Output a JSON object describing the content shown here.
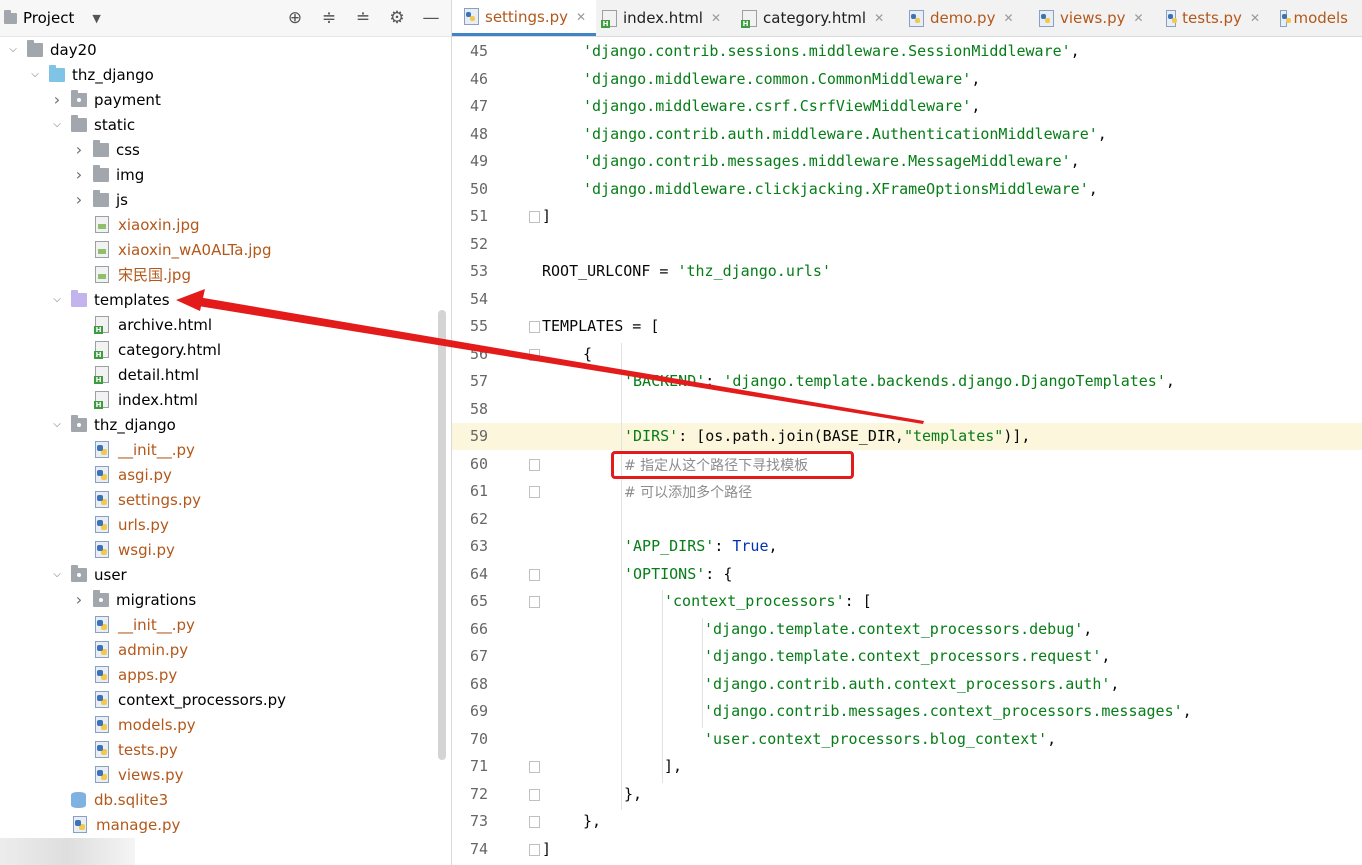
{
  "project_panel": {
    "title": "Project",
    "tree": [
      {
        "label": "day20",
        "level": 0,
        "arrow": "open",
        "icon": "folder",
        "color": "normal"
      },
      {
        "label": "thz_django",
        "level": 1,
        "arrow": "open",
        "icon": "folder-blue",
        "color": "normal"
      },
      {
        "label": "payment",
        "level": 2,
        "arrow": "closed",
        "icon": "folder-pkg",
        "color": "normal"
      },
      {
        "label": "static",
        "level": 2,
        "arrow": "open",
        "icon": "folder",
        "color": "normal"
      },
      {
        "label": "css",
        "level": 3,
        "arrow": "closed",
        "icon": "folder",
        "color": "normal"
      },
      {
        "label": "img",
        "level": 3,
        "arrow": "closed",
        "icon": "folder",
        "color": "normal"
      },
      {
        "label": "js",
        "level": 3,
        "arrow": "closed",
        "icon": "folder",
        "color": "normal"
      },
      {
        "label": "xiaoxin.jpg",
        "level": 3,
        "arrow": "none",
        "icon": "file-img",
        "color": "orange"
      },
      {
        "label": "xiaoxin_wA0ALTa.jpg",
        "level": 3,
        "arrow": "none",
        "icon": "file-img",
        "color": "orange"
      },
      {
        "label": "宋民国.jpg",
        "level": 3,
        "arrow": "none",
        "icon": "file-img",
        "color": "orange"
      },
      {
        "label": "templates",
        "level": 2,
        "arrow": "open",
        "icon": "folder-purple",
        "color": "normal"
      },
      {
        "label": "archive.html",
        "level": 3,
        "arrow": "none",
        "icon": "file-html",
        "color": "normal"
      },
      {
        "label": "category.html",
        "level": 3,
        "arrow": "none",
        "icon": "file-html",
        "color": "normal"
      },
      {
        "label": "detail.html",
        "level": 3,
        "arrow": "none",
        "icon": "file-html",
        "color": "normal"
      },
      {
        "label": "index.html",
        "level": 3,
        "arrow": "none",
        "icon": "file-html",
        "color": "normal"
      },
      {
        "label": "thz_django",
        "level": 2,
        "arrow": "open",
        "icon": "folder-pkg",
        "color": "normal"
      },
      {
        "label": "__init__.py",
        "level": 3,
        "arrow": "none",
        "icon": "file-py",
        "color": "orange"
      },
      {
        "label": "asgi.py",
        "level": 3,
        "arrow": "none",
        "icon": "file-py",
        "color": "orange"
      },
      {
        "label": "settings.py",
        "level": 3,
        "arrow": "none",
        "icon": "file-py",
        "color": "orange"
      },
      {
        "label": "urls.py",
        "level": 3,
        "arrow": "none",
        "icon": "file-py",
        "color": "orange"
      },
      {
        "label": "wsgi.py",
        "level": 3,
        "arrow": "none",
        "icon": "file-py",
        "color": "orange"
      },
      {
        "label": "user",
        "level": 2,
        "arrow": "open",
        "icon": "folder-pkg",
        "color": "normal"
      },
      {
        "label": "migrations",
        "level": 3,
        "arrow": "closed",
        "icon": "folder-pkg",
        "color": "normal"
      },
      {
        "label": "__init__.py",
        "level": 3,
        "arrow": "none",
        "icon": "file-py",
        "color": "orange"
      },
      {
        "label": "admin.py",
        "level": 3,
        "arrow": "none",
        "icon": "file-py",
        "color": "orange"
      },
      {
        "label": "apps.py",
        "level": 3,
        "arrow": "none",
        "icon": "file-py",
        "color": "orange"
      },
      {
        "label": "context_processors.py",
        "level": 3,
        "arrow": "none",
        "icon": "file-py",
        "color": "normal"
      },
      {
        "label": "models.py",
        "level": 3,
        "arrow": "none",
        "icon": "file-py",
        "color": "orange"
      },
      {
        "label": "tests.py",
        "level": 3,
        "arrow": "none",
        "icon": "file-py",
        "color": "orange"
      },
      {
        "label": "views.py",
        "level": 3,
        "arrow": "none",
        "icon": "file-py",
        "color": "orange"
      },
      {
        "label": "db.sqlite3",
        "level": 2,
        "arrow": "none",
        "icon": "db",
        "color": "orange"
      },
      {
        "label": "manage.py",
        "level": 2,
        "arrow": "none",
        "icon": "file-py",
        "color": "orange"
      }
    ]
  },
  "tabs": [
    {
      "label": "settings.py",
      "icon": "py",
      "active": true,
      "orange": true
    },
    {
      "label": "index.html",
      "icon": "html",
      "active": false,
      "orange": false
    },
    {
      "label": "category.html",
      "icon": "html",
      "active": false,
      "orange": false
    },
    {
      "label": "demo.py",
      "icon": "py",
      "active": false,
      "orange": true
    },
    {
      "label": "views.py",
      "icon": "py",
      "active": false,
      "orange": true
    },
    {
      "label": "tests.py",
      "icon": "py",
      "active": false,
      "orange": true
    },
    {
      "label": "models",
      "icon": "py",
      "active": false,
      "orange": true
    }
  ],
  "editor": {
    "highlighted_line": "59",
    "lines": [
      {
        "n": "45",
        "indent": 1,
        "parts": [
          [
            "str",
            "'django.contrib.sessions.middleware.SessionMiddleware'"
          ],
          [
            "p",
            ","
          ]
        ]
      },
      {
        "n": "46",
        "indent": 1,
        "parts": [
          [
            "str",
            "'django.middleware.common.CommonMiddleware'"
          ],
          [
            "p",
            ","
          ]
        ]
      },
      {
        "n": "47",
        "indent": 1,
        "parts": [
          [
            "str",
            "'django.middleware.csrf.CsrfViewMiddleware'"
          ],
          [
            "p",
            ","
          ]
        ]
      },
      {
        "n": "48",
        "indent": 1,
        "parts": [
          [
            "str",
            "'django.contrib.auth.middleware.AuthenticationMiddleware'"
          ],
          [
            "p",
            ","
          ]
        ]
      },
      {
        "n": "49",
        "indent": 1,
        "parts": [
          [
            "str",
            "'django.contrib.messages.middleware.MessageMiddleware'"
          ],
          [
            "p",
            ","
          ]
        ]
      },
      {
        "n": "50",
        "indent": 1,
        "parts": [
          [
            "str",
            "'django.middleware.clickjacking.XFrameOptionsMiddleware'"
          ],
          [
            "p",
            ","
          ]
        ]
      },
      {
        "n": "51",
        "indent": 0,
        "parts": [
          [
            "p",
            "]"
          ]
        ]
      },
      {
        "n": "52",
        "indent": 0,
        "parts": []
      },
      {
        "n": "53",
        "indent": 0,
        "parts": [
          [
            "p",
            "ROOT_URLCONF = "
          ],
          [
            "str",
            "'thz_django.urls'"
          ]
        ]
      },
      {
        "n": "54",
        "indent": 0,
        "parts": []
      },
      {
        "n": "55",
        "indent": 0,
        "parts": [
          [
            "p",
            "TEMPLATES = ["
          ]
        ]
      },
      {
        "n": "56",
        "indent": 1,
        "parts": [
          [
            "p",
            "{"
          ]
        ]
      },
      {
        "n": "57",
        "indent": 2,
        "parts": [
          [
            "str",
            "'BACKEND'"
          ],
          [
            "p",
            ": "
          ],
          [
            "str",
            "'django.template.backends.django.DjangoTemplates'"
          ],
          [
            "p",
            ","
          ]
        ]
      },
      {
        "n": "58",
        "indent": 0,
        "parts": []
      },
      {
        "n": "59",
        "indent": 2,
        "parts": [
          [
            "str",
            "'DIRS'"
          ],
          [
            "p",
            ": [os.path.join(BASE_DIR,"
          ],
          [
            "str",
            "\"templates\""
          ],
          [
            "p",
            ")],"
          ]
        ]
      },
      {
        "n": "60",
        "indent": 2,
        "parts": [
          [
            "cmt",
            "# 指定从这个路径下寻找模板"
          ]
        ]
      },
      {
        "n": "61",
        "indent": 2,
        "parts": [
          [
            "cmt",
            "# 可以添加多个路径"
          ]
        ]
      },
      {
        "n": "62",
        "indent": 0,
        "parts": []
      },
      {
        "n": "63",
        "indent": 2,
        "parts": [
          [
            "str",
            "'APP_DIRS'"
          ],
          [
            "p",
            ": "
          ],
          [
            "kw",
            "True"
          ],
          [
            "p",
            ","
          ]
        ]
      },
      {
        "n": "64",
        "indent": 2,
        "parts": [
          [
            "str",
            "'OPTIONS'"
          ],
          [
            "p",
            ": {"
          ]
        ]
      },
      {
        "n": "65",
        "indent": 3,
        "parts": [
          [
            "str",
            "'context_processors'"
          ],
          [
            "p",
            ": ["
          ]
        ]
      },
      {
        "n": "66",
        "indent": 4,
        "parts": [
          [
            "str",
            "'django.template.context_processors.debug'"
          ],
          [
            "p",
            ","
          ]
        ]
      },
      {
        "n": "67",
        "indent": 4,
        "parts": [
          [
            "str",
            "'django.template.context_processors.request'"
          ],
          [
            "p",
            ","
          ]
        ]
      },
      {
        "n": "68",
        "indent": 4,
        "parts": [
          [
            "str",
            "'django.contrib.auth.context_processors.auth'"
          ],
          [
            "p",
            ","
          ]
        ]
      },
      {
        "n": "69",
        "indent": 4,
        "parts": [
          [
            "str",
            "'django.contrib.messages.context_processors.messages'"
          ],
          [
            "p",
            ","
          ]
        ]
      },
      {
        "n": "70",
        "indent": 4,
        "parts": [
          [
            "str",
            "'user.context_processors.blog_context'"
          ],
          [
            "p",
            ","
          ]
        ]
      },
      {
        "n": "71",
        "indent": 3,
        "parts": [
          [
            "p",
            "],"
          ]
        ]
      },
      {
        "n": "72",
        "indent": 2,
        "parts": [
          [
            "p",
            "},"
          ]
        ]
      },
      {
        "n": "73",
        "indent": 1,
        "parts": [
          [
            "p",
            "},"
          ]
        ]
      },
      {
        "n": "74",
        "indent": 0,
        "parts": [
          [
            "p",
            "]"
          ]
        ]
      }
    ]
  },
  "colors": {
    "string": "#067d17",
    "keyword": "#0033b3",
    "comment": "#8c8c8c",
    "annotation_red": "#e31b1b",
    "tab_underline": "#4083c9",
    "highlight_line": "#fcf6dc"
  }
}
